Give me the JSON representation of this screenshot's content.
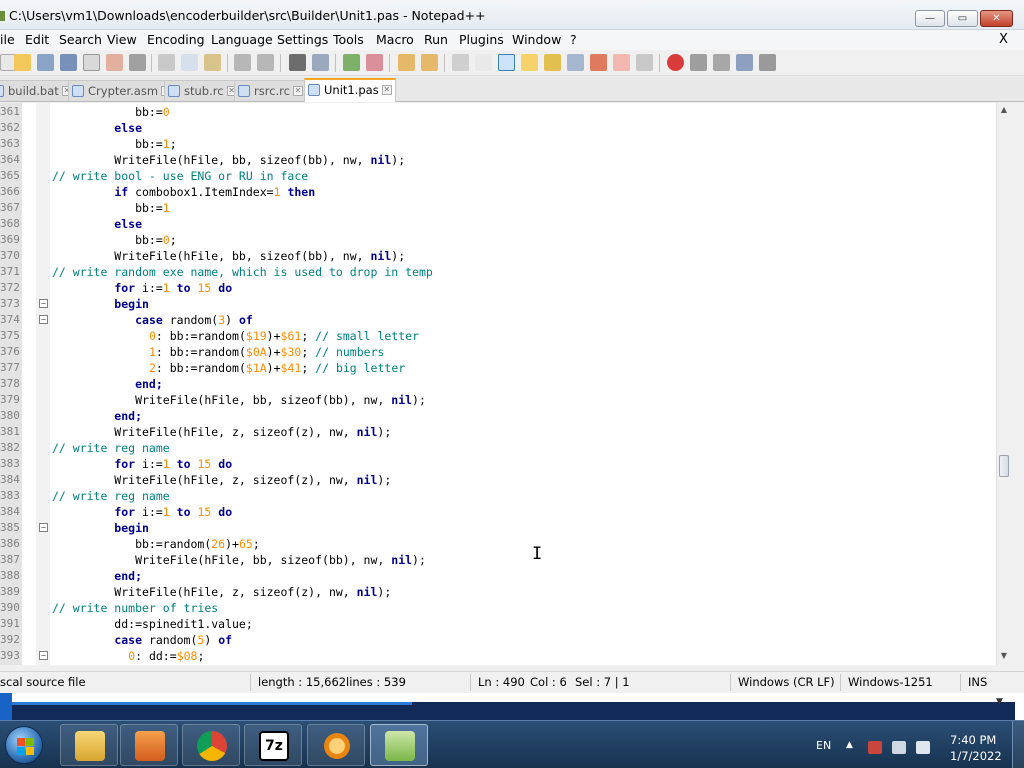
{
  "window": {
    "title": "C:\\Users\\vm1\\Downloads\\encoderbuilder\\src\\Builder\\Unit1.pas - Notepad++",
    "minimize": "—",
    "maximize": "▭",
    "close": "✕"
  },
  "menu": {
    "items": [
      "ile",
      "Edit",
      "Search",
      "View",
      "Encoding",
      "Language",
      "Settings",
      "Tools",
      "Macro",
      "Run",
      "Plugins",
      "Window",
      "?"
    ],
    "close_doc": "X"
  },
  "tabs": [
    {
      "label": "build.bat",
      "active": false
    },
    {
      "label": "Crypter.asm",
      "active": false
    },
    {
      "label": "stub.rc",
      "active": false
    },
    {
      "label": "rsrc.rc",
      "active": false
    },
    {
      "label": "Unit1.pas",
      "active": true
    }
  ],
  "tab_close_glyph": "✕",
  "code_lines": [
    {
      "n": "361",
      "fold": "",
      "segs": [
        {
          "t": "            bb:=",
          "c": ""
        },
        {
          "t": "0",
          "c": "num"
        }
      ]
    },
    {
      "n": "362",
      "fold": "",
      "segs": [
        {
          "t": "         else",
          "c": "kw"
        }
      ]
    },
    {
      "n": "363",
      "fold": "",
      "segs": [
        {
          "t": "            bb:=",
          "c": ""
        },
        {
          "t": "1",
          "c": "num"
        },
        {
          "t": ";",
          "c": ""
        }
      ]
    },
    {
      "n": "364",
      "fold": "",
      "segs": [
        {
          "t": "         WriteFile(hFile, bb, sizeof(bb), nw, ",
          "c": ""
        },
        {
          "t": "nil",
          "c": "kw"
        },
        {
          "t": ");",
          "c": ""
        }
      ]
    },
    {
      "n": "365",
      "fold": "",
      "segs": [
        {
          "t": "// write bool - use ENG or RU in face",
          "c": "cmt"
        }
      ]
    },
    {
      "n": "366",
      "fold": "",
      "segs": [
        {
          "t": "         ",
          "c": ""
        },
        {
          "t": "if",
          "c": "kw"
        },
        {
          "t": " combobox1.ItemIndex=",
          "c": ""
        },
        {
          "t": "1",
          "c": "num"
        },
        {
          "t": " ",
          "c": ""
        },
        {
          "t": "then",
          "c": "kw"
        }
      ]
    },
    {
      "n": "367",
      "fold": "",
      "segs": [
        {
          "t": "            bb:=",
          "c": ""
        },
        {
          "t": "1",
          "c": "num"
        }
      ]
    },
    {
      "n": "368",
      "fold": "",
      "segs": [
        {
          "t": "         else",
          "c": "kw"
        }
      ]
    },
    {
      "n": "369",
      "fold": "",
      "segs": [
        {
          "t": "            bb:=",
          "c": ""
        },
        {
          "t": "0",
          "c": "num"
        },
        {
          "t": ";",
          "c": ""
        }
      ]
    },
    {
      "n": "370",
      "fold": "",
      "segs": [
        {
          "t": "         WriteFile(hFile, bb, sizeof(bb), nw, ",
          "c": ""
        },
        {
          "t": "nil",
          "c": "kw"
        },
        {
          "t": ");",
          "c": ""
        }
      ]
    },
    {
      "n": "371",
      "fold": "",
      "segs": [
        {
          "t": "// write random exe name, which is used to drop in temp",
          "c": "cmt"
        }
      ]
    },
    {
      "n": "372",
      "fold": "",
      "segs": [
        {
          "t": "         ",
          "c": ""
        },
        {
          "t": "for",
          "c": "kw"
        },
        {
          "t": " i:=",
          "c": ""
        },
        {
          "t": "1",
          "c": "num"
        },
        {
          "t": " ",
          "c": ""
        },
        {
          "t": "to",
          "c": "kw"
        },
        {
          "t": " ",
          "c": ""
        },
        {
          "t": "15",
          "c": "num"
        },
        {
          "t": " ",
          "c": ""
        },
        {
          "t": "do",
          "c": "kw"
        }
      ]
    },
    {
      "n": "373",
      "fold": "−",
      "segs": [
        {
          "t": "         begin",
          "c": "kw"
        }
      ]
    },
    {
      "n": "374",
      "fold": "−",
      "segs": [
        {
          "t": "            ",
          "c": ""
        },
        {
          "t": "case",
          "c": "kw"
        },
        {
          "t": " random(",
          "c": ""
        },
        {
          "t": "3",
          "c": "num"
        },
        {
          "t": ") ",
          "c": ""
        },
        {
          "t": "of",
          "c": "kw"
        }
      ]
    },
    {
      "n": "375",
      "fold": "",
      "segs": [
        {
          "t": "              ",
          "c": ""
        },
        {
          "t": "0",
          "c": "num"
        },
        {
          "t": ": bb:=random(",
          "c": ""
        },
        {
          "t": "$19",
          "c": "num"
        },
        {
          "t": ")+",
          "c": ""
        },
        {
          "t": "$61",
          "c": "num"
        },
        {
          "t": "; ",
          "c": ""
        },
        {
          "t": "// small letter",
          "c": "cmt"
        }
      ]
    },
    {
      "n": "376",
      "fold": "",
      "segs": [
        {
          "t": "              ",
          "c": ""
        },
        {
          "t": "1",
          "c": "num"
        },
        {
          "t": ": bb:=random(",
          "c": ""
        },
        {
          "t": "$0A",
          "c": "num"
        },
        {
          "t": ")+",
          "c": ""
        },
        {
          "t": "$30",
          "c": "num"
        },
        {
          "t": "; ",
          "c": ""
        },
        {
          "t": "// numbers",
          "c": "cmt"
        }
      ]
    },
    {
      "n": "377",
      "fold": "",
      "segs": [
        {
          "t": "              ",
          "c": ""
        },
        {
          "t": "2",
          "c": "num"
        },
        {
          "t": ": bb:=random(",
          "c": ""
        },
        {
          "t": "$1A",
          "c": "num"
        },
        {
          "t": ")+",
          "c": ""
        },
        {
          "t": "$41",
          "c": "num"
        },
        {
          "t": "; ",
          "c": ""
        },
        {
          "t": "// big letter",
          "c": "cmt"
        }
      ]
    },
    {
      "n": "378",
      "fold": "",
      "segs": [
        {
          "t": "            end;",
          "c": "kw"
        }
      ]
    },
    {
      "n": "379",
      "fold": "",
      "segs": [
        {
          "t": "            WriteFile(hFile, bb, sizeof(bb), nw, ",
          "c": ""
        },
        {
          "t": "nil",
          "c": "kw"
        },
        {
          "t": ");",
          "c": ""
        }
      ]
    },
    {
      "n": "380",
      "fold": "",
      "segs": [
        {
          "t": "         end;",
          "c": "kw"
        }
      ]
    },
    {
      "n": "381",
      "fold": "",
      "segs": [
        {
          "t": "         WriteFile(hFile, z, sizeof(z), nw, ",
          "c": ""
        },
        {
          "t": "nil",
          "c": "kw"
        },
        {
          "t": ");",
          "c": ""
        }
      ]
    },
    {
      "n": "382",
      "fold": "",
      "segs": [
        {
          "t": "// write reg name",
          "c": "cmt"
        }
      ]
    },
    {
      "n": "383",
      "fold": "",
      "segs": [
        {
          "t": "         ",
          "c": ""
        },
        {
          "t": "for",
          "c": "kw"
        },
        {
          "t": " i:=",
          "c": ""
        },
        {
          "t": "1",
          "c": "num"
        },
        {
          "t": " ",
          "c": ""
        },
        {
          "t": "to",
          "c": "kw"
        },
        {
          "t": " ",
          "c": ""
        },
        {
          "t": "15",
          "c": "num"
        },
        {
          "t": " ",
          "c": ""
        },
        {
          "t": "do",
          "c": "kw"
        }
      ]
    },
    {
      "n": "384",
      "fold": "",
      "segs": [
        {
          "t": "         WriteFile(hFile, z, sizeof(z), nw, ",
          "c": ""
        },
        {
          "t": "nil",
          "c": "kw"
        },
        {
          "t": ");",
          "c": ""
        }
      ]
    },
    {
      "n": "383",
      "fold": "",
      "segs": [
        {
          "t": "// write reg name",
          "c": "cmt"
        }
      ]
    },
    {
      "n": "384",
      "fold": "",
      "segs": [
        {
          "t": "         ",
          "c": ""
        },
        {
          "t": "for",
          "c": "kw"
        },
        {
          "t": " i:=",
          "c": ""
        },
        {
          "t": "1",
          "c": "num"
        },
        {
          "t": " ",
          "c": ""
        },
        {
          "t": "to",
          "c": "kw"
        },
        {
          "t": " ",
          "c": ""
        },
        {
          "t": "15",
          "c": "num"
        },
        {
          "t": " ",
          "c": ""
        },
        {
          "t": "do",
          "c": "kw"
        }
      ]
    },
    {
      "n": "385",
      "fold": "−",
      "segs": [
        {
          "t": "         begin",
          "c": "kw"
        }
      ]
    },
    {
      "n": "386",
      "fold": "",
      "segs": [
        {
          "t": "            bb:=random(",
          "c": ""
        },
        {
          "t": "26",
          "c": "num"
        },
        {
          "t": ")+",
          "c": ""
        },
        {
          "t": "65",
          "c": "num"
        },
        {
          "t": ";",
          "c": ""
        }
      ]
    },
    {
      "n": "387",
      "fold": "",
      "segs": [
        {
          "t": "            WriteFile(hFile, bb, sizeof(bb), nw, ",
          "c": ""
        },
        {
          "t": "nil",
          "c": "kw"
        },
        {
          "t": ");",
          "c": ""
        }
      ]
    },
    {
      "n": "388",
      "fold": "",
      "segs": [
        {
          "t": "         end;",
          "c": "kw"
        }
      ]
    },
    {
      "n": "389",
      "fold": "",
      "segs": [
        {
          "t": "         WriteFile(hFile, z, sizeof(z), nw, ",
          "c": ""
        },
        {
          "t": "nil",
          "c": "kw"
        },
        {
          "t": ");",
          "c": ""
        }
      ]
    },
    {
      "n": "390",
      "fold": "",
      "segs": [
        {
          "t": "// write number of tries",
          "c": "cmt"
        }
      ]
    },
    {
      "n": "391",
      "fold": "",
      "segs": [
        {
          "t": "         dd:=spinedit1.value;",
          "c": ""
        }
      ]
    },
    {
      "n": "392",
      "fold": "",
      "segs": [
        {
          "t": "         ",
          "c": ""
        },
        {
          "t": "case",
          "c": "kw"
        },
        {
          "t": " random(",
          "c": ""
        },
        {
          "t": "5",
          "c": "num"
        },
        {
          "t": ") ",
          "c": ""
        },
        {
          "t": "of",
          "c": "kw"
        }
      ]
    },
    {
      "n": "393",
      "fold": "−",
      "segs": [
        {
          "t": "           ",
          "c": ""
        },
        {
          "t": "0",
          "c": "num"
        },
        {
          "t": ": dd:=",
          "c": ""
        },
        {
          "t": "$08",
          "c": "num"
        },
        {
          "t": ";",
          "c": ""
        }
      ]
    }
  ],
  "scroll": {
    "up": "▲",
    "down": "▼"
  },
  "cursor_glyph": "I",
  "status": {
    "file_type": "scal source file",
    "length": "length : 15,662",
    "lines": "lines : 539",
    "ln": "Ln : 490",
    "col": "Col : 6",
    "sel": "Sel : 7 | 1",
    "eol": "Windows (CR LF)",
    "encoding": "Windows-1251",
    "mode": "INS"
  },
  "lower_arrow": "▼",
  "taskbar": {
    "apps": [
      "explorer",
      "media-player",
      "chrome",
      "7zip",
      "search-tool",
      "notepad-plus-plus"
    ],
    "lang": "EN",
    "tray_up": "▲",
    "time": "7:40 PM",
    "date": "1/7/2022"
  },
  "colors": {
    "keyword": "#00008b",
    "number": "#ff8c00",
    "comment": "#008080",
    "taskbar": "#1e3a5c"
  }
}
